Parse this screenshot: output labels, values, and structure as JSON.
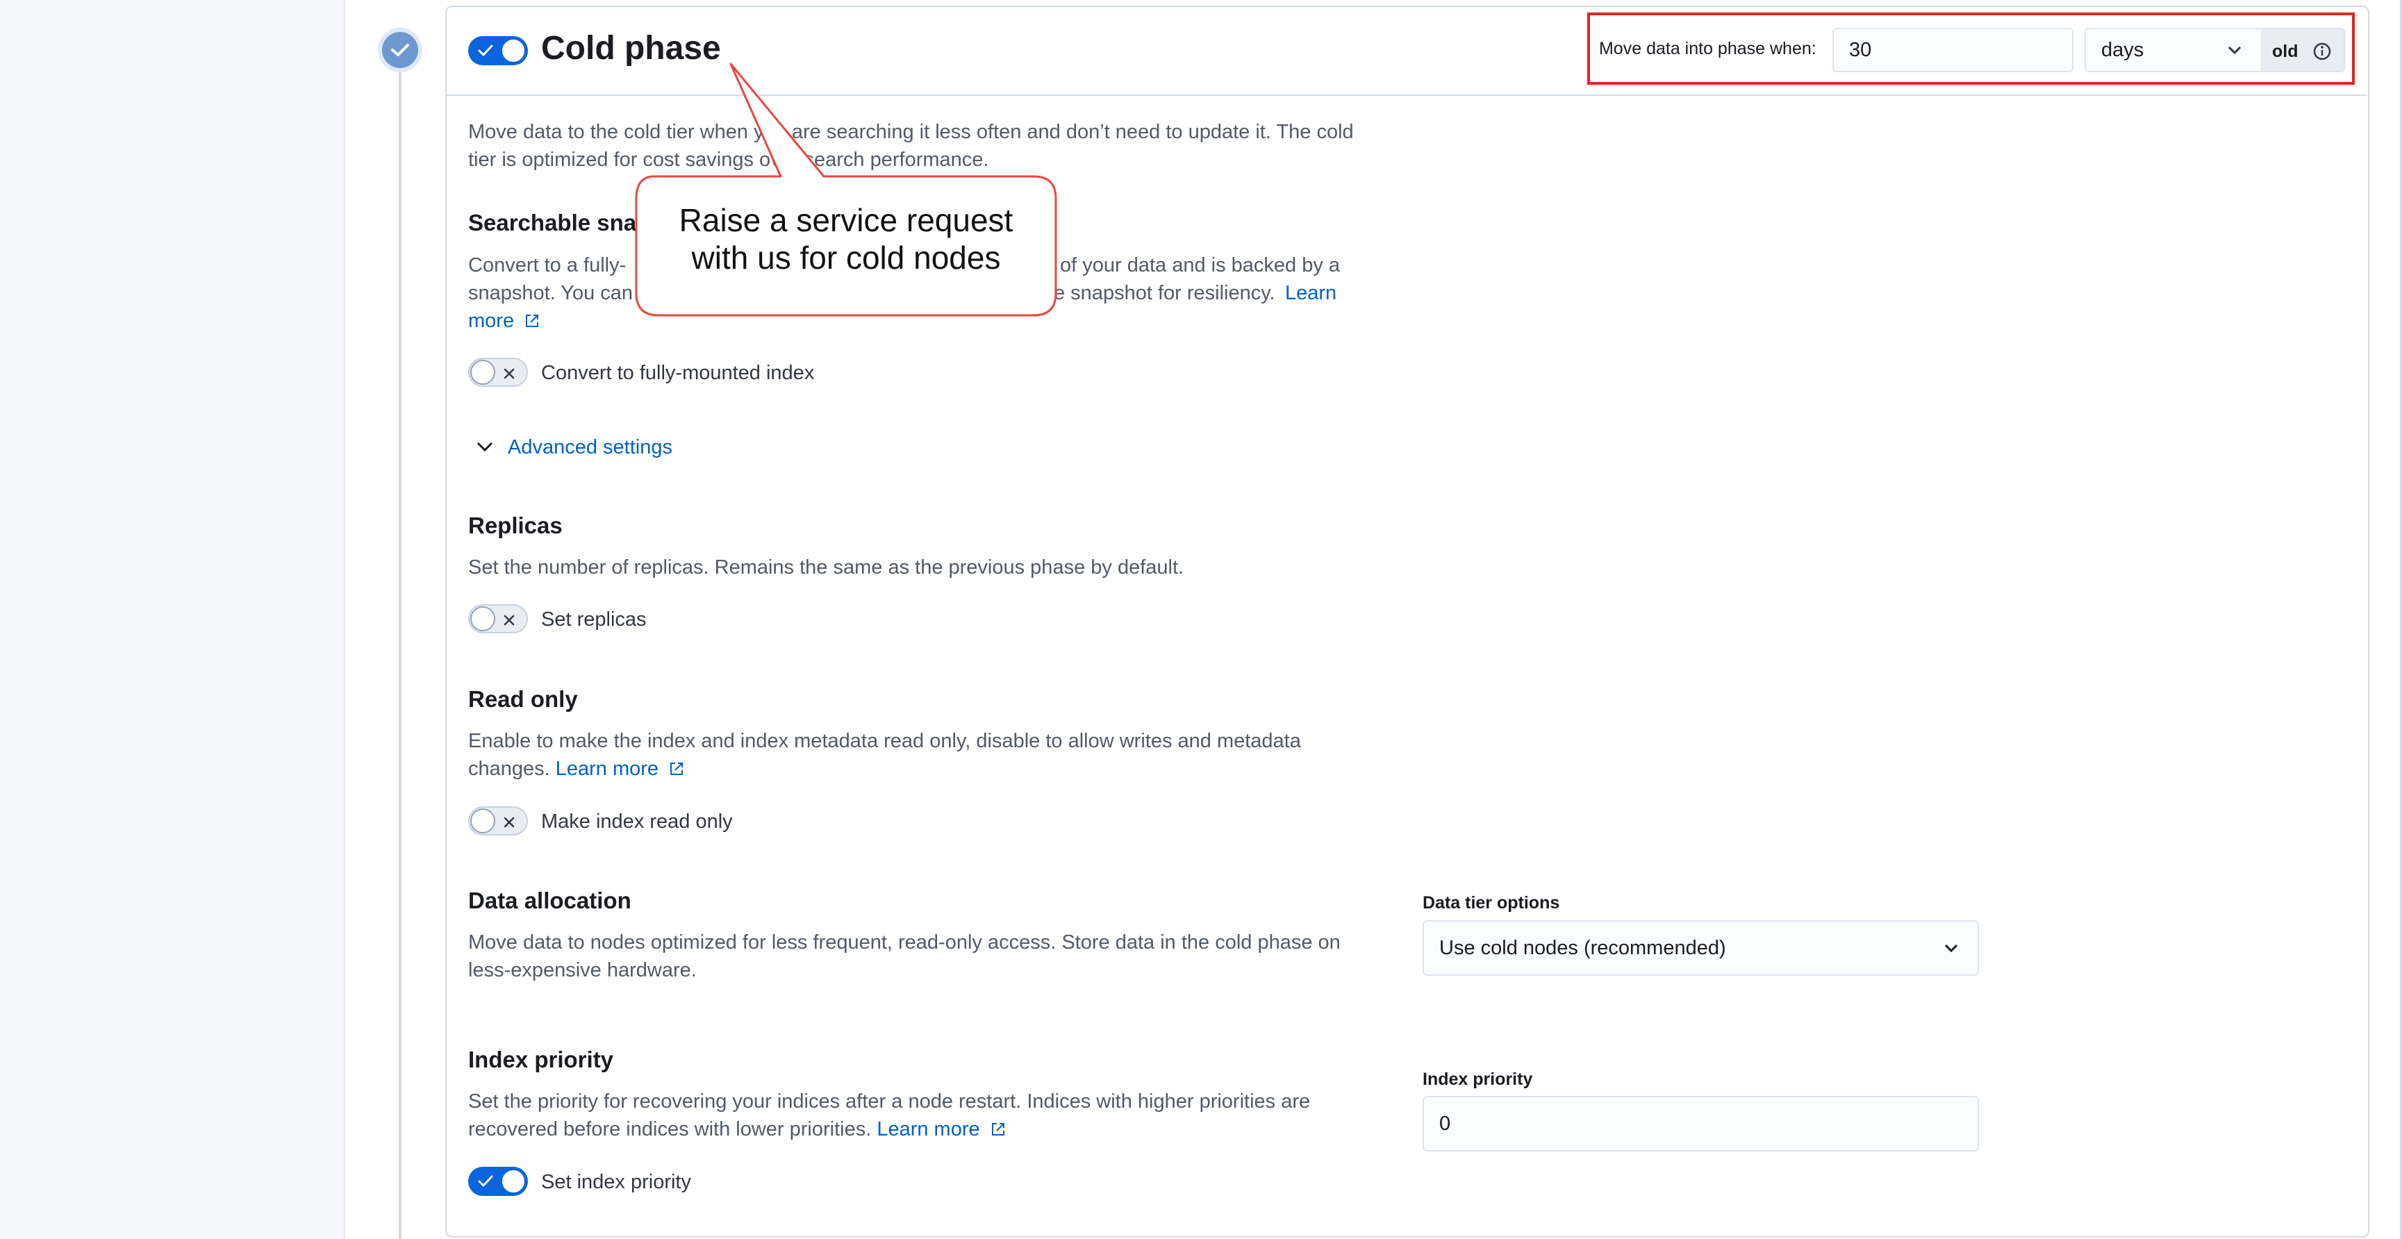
{
  "phase": {
    "title": "Cold phase",
    "enabled": true,
    "description": "Move data to the cold tier when you are searching it less often and don’t need to update it. The cold tier is optimized for cost savings over search performance.",
    "description_line1": "Move data to the cold tier when you are searching it less often and don’t need to update it. The cold",
    "description_line2": "tier is optimized for cost savings over search performance."
  },
  "move_data": {
    "label": "Move data into phase when:",
    "value": "30",
    "unit": "days",
    "suffix": "old",
    "info_icon": "info-icon"
  },
  "searchable_snapshot": {
    "title": "Searchable snapshot",
    "title_visible": "Searchable sna",
    "desc_line1_a": "Convert to a fully-",
    "desc_line1_b": "of your data and is backed by a",
    "desc_line2_a": "snapshot. You can",
    "desc_line2_b": "e snapshot for resiliency.",
    "learn_more_1": "Learn",
    "learn_more_2": "more",
    "toggle_label": "Convert to fully-mounted index",
    "enabled": false
  },
  "advanced_settings": {
    "label": "Advanced settings"
  },
  "replicas": {
    "title": "Replicas",
    "description": "Set the number of replicas. Remains the same as the previous phase by default.",
    "toggle_label": "Set replicas",
    "enabled": false
  },
  "read_only": {
    "title": "Read only",
    "desc_line1": "Enable to make the index and index metadata read only, disable to allow writes and metadata",
    "desc_line2": "changes.",
    "learn_more": "Learn more",
    "toggle_label": "Make index read only",
    "enabled": false
  },
  "data_allocation": {
    "title": "Data allocation",
    "desc_line1": "Move data to nodes optimized for less frequent, read-only access. Store data in the cold phase on",
    "desc_line2": "less-expensive hardware.",
    "tier_label": "Data tier options",
    "tier_value": "Use cold nodes (recommended)"
  },
  "index_priority": {
    "title": "Index priority",
    "desc_line1": "Set the priority for recovering your indices after a node restart. Indices with higher priorities are",
    "desc_line2": "recovered before indices with lower priorities.",
    "learn_more": "Learn more",
    "field_label": "Index priority",
    "value": "0",
    "toggle_label": "Set index priority",
    "enabled": true
  },
  "annotation": {
    "line1": "Raise a service request",
    "line2": "with us for cold nodes",
    "color": "#e9483f"
  },
  "colors": {
    "primary": "#0b64dd",
    "link": "#0061c2",
    "highlight_border": "#e52522"
  }
}
